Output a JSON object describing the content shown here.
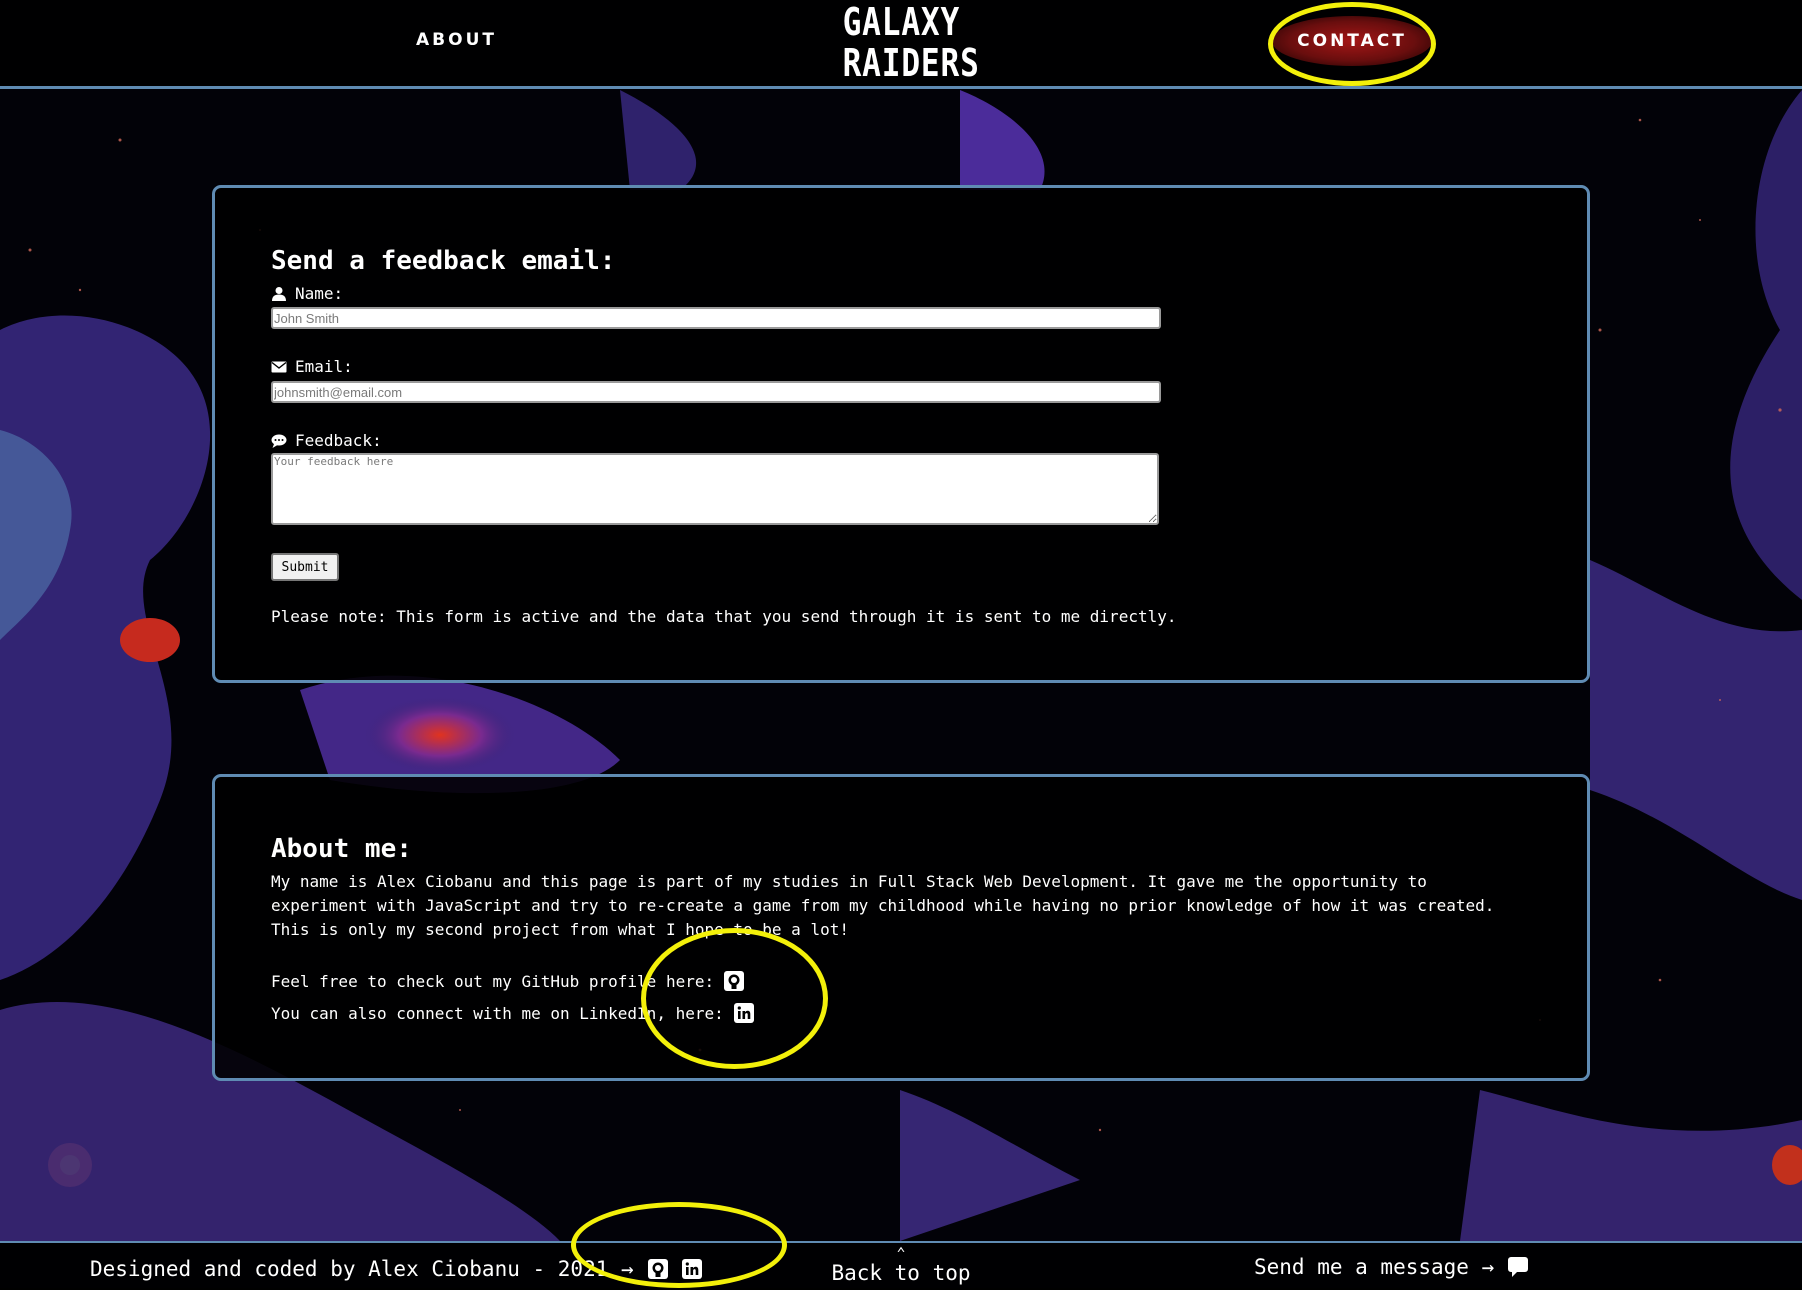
{
  "nav": {
    "about": "ABOUT",
    "logo_line1": "GALAXY",
    "logo_line2": "RAIDERS",
    "contact": "CONTACT"
  },
  "form": {
    "title": "Send a feedback email:",
    "name_label": "Name:",
    "name_placeholder": "John Smith",
    "email_label": "Email:",
    "email_placeholder": "johnsmith@email.com",
    "feedback_label": "Feedback:",
    "feedback_placeholder": "Your feedback here",
    "submit": "Submit",
    "note": "Please note: This form is active and the data that you send through it is sent to me directly."
  },
  "about": {
    "title": "About me:",
    "body": "My name is Alex Ciobanu and this page is part of my studies in Full Stack Web Development. It gave me the opportunity to experiment with JavaScript and try to re-create a game from my childhood while having no prior knowledge of how it was created. This is only my second project from what I hope to be a lot!",
    "github_line": "Feel free to check out my GitHub profile here:",
    "linkedin_line": "You can also connect with me on LinkedIn, here:"
  },
  "footer": {
    "credit": "Designed and coded by Alex Ciobanu - 2021 →",
    "back_to_top": "Back to top",
    "message": "Send me a message →"
  },
  "icons": {
    "user": "user-icon",
    "envelope": "envelope-icon",
    "comment": "comment-icon",
    "github": "github-icon",
    "linkedin": "linkedin-icon",
    "chat": "chat-bubble-icon",
    "caret": "caret-up-icon"
  },
  "colors": {
    "accent_border": "#5f8bb3",
    "highlight": "#f3f00a",
    "contact_glow": "#a31616",
    "nebula_purple": "#4b2c9a",
    "nebula_red": "#d32a1f"
  }
}
